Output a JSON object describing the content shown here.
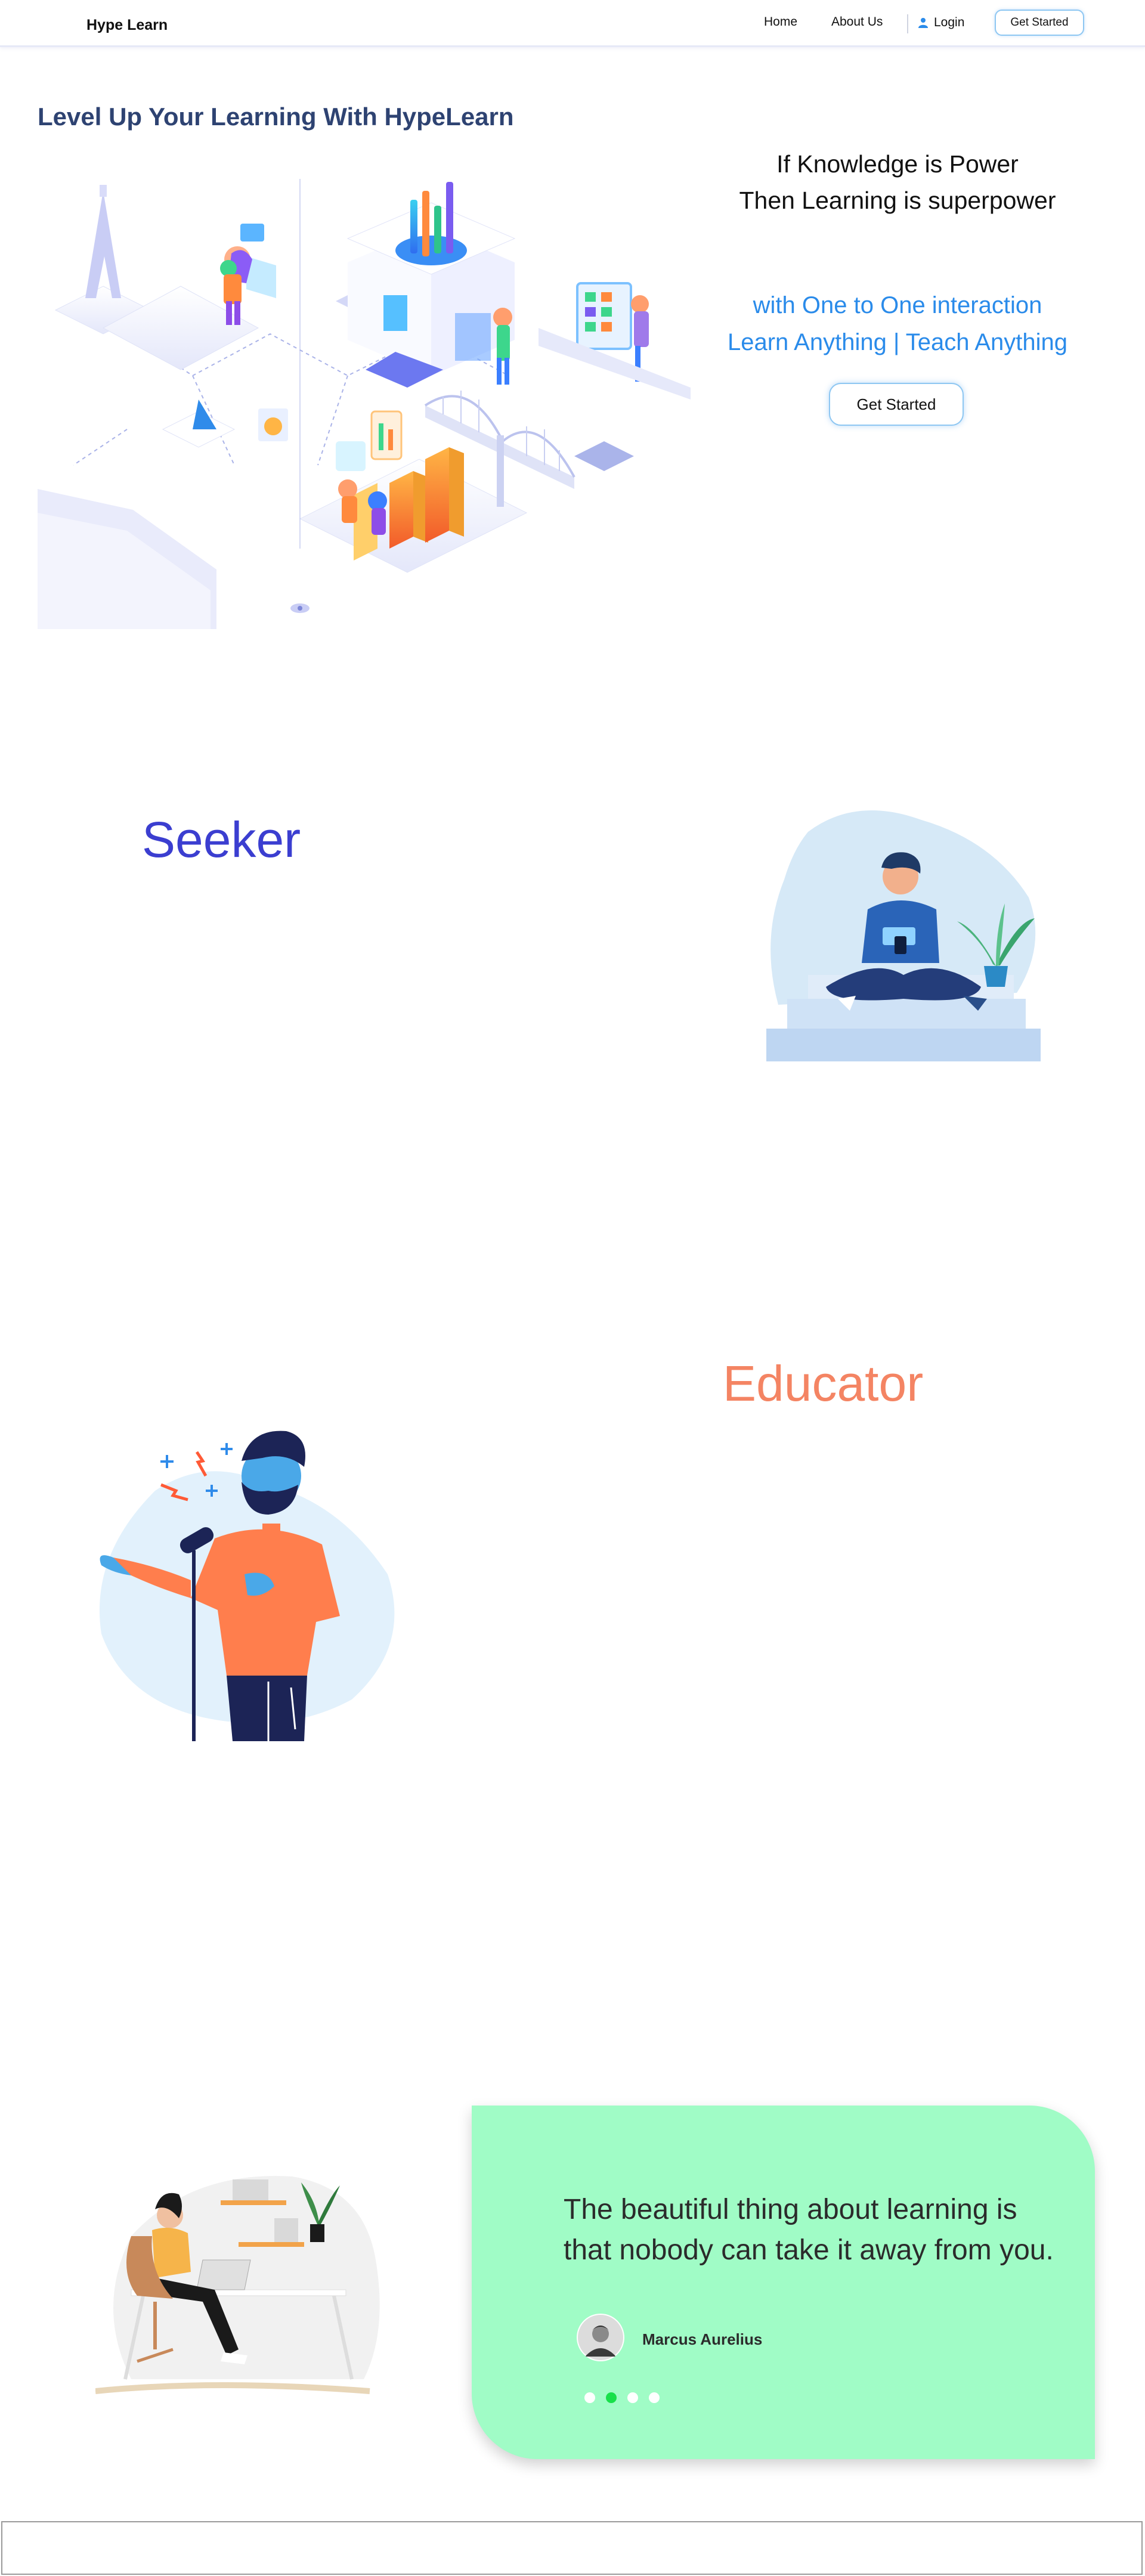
{
  "navbar": {
    "brand": "Hype Learn",
    "home": "Home",
    "about": "About Us",
    "login": "Login",
    "cta": "Get Started"
  },
  "hero": {
    "title": "Level Up Your Learning With HypeLearn",
    "tagline_line1": "If Knowledge is Power",
    "tagline_line2": "Then Learning is superpower",
    "blue_line1": "with One to One interaction",
    "blue_line2": "Learn Anything | Teach Anything",
    "cta": "Get Started",
    "illustration": "isometric-learning-platform-illustration"
  },
  "seeker": {
    "title": "Seeker",
    "illustration": "man-sitting-with-phone-illustration"
  },
  "educator": {
    "title": "Educator",
    "illustration": "bearded-man-speaking-microphone-illustration"
  },
  "testimonial": {
    "illustration": "woman-studying-at-desk-illustration",
    "quote_line1": "The beautiful thing about learning is",
    "quote_line2": "that nobody can take it away from you.",
    "author": "Marcus Aurelius",
    "slides_count": 4,
    "active_slide": 2
  },
  "colors": {
    "accent_blue": "#2a8bea",
    "seeker_purple": "#3b3ed0",
    "educator_coral": "#f48463",
    "title_navy": "#2e4372",
    "quote_card": "#a0fcc6",
    "active_dot": "#18e04a"
  }
}
